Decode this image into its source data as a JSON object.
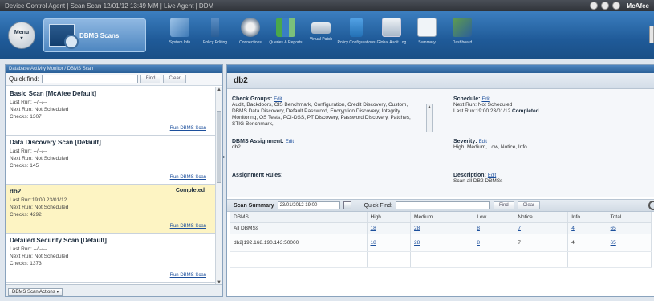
{
  "window": {
    "title": "Device Control Agent | Scan Scan 12/01/12 13:49 MM | Live Agent | DDM",
    "brand": "McAfee"
  },
  "ribbon": {
    "menu_label": "Menu",
    "active_tool": "DBMS Scans",
    "tools": [
      {
        "label": "System Info",
        "icon": "system-info-icon"
      },
      {
        "label": "Policy Editing",
        "icon": "policy-editing-icon"
      },
      {
        "label": "Connections",
        "icon": "connections-icon"
      },
      {
        "label": "Queries & Reports",
        "icon": "reports-icon"
      },
      {
        "label": "Virtual Patch",
        "icon": "virtual-patch-icon"
      },
      {
        "label": "Policy Configurations",
        "icon": "policy-config-icon"
      },
      {
        "label": "Global Audit Log",
        "icon": "audit-log-icon"
      },
      {
        "label": "Summary",
        "icon": "summary-icon"
      },
      {
        "label": "Dashboard",
        "icon": "dashboard-icon"
      }
    ]
  },
  "left": {
    "header": "Database Activity Monitor / DBMS Scan",
    "quickfind_label": "Quick find:",
    "find_btn": "Find",
    "clear_btn": "Clear",
    "footer_btn": "DBMS Scan Actions ▾",
    "scans": [
      {
        "name": "Basic Scan [McAfee Default]",
        "status": "",
        "last": "Last Run: --/--/--",
        "next": "Next Run: Not Scheduled",
        "checks": "Checks: 1307",
        "run": "Run DBMS Scan"
      },
      {
        "name": "Data Discovery Scan [Default]",
        "status": "",
        "last": "Last Run: --/--/--",
        "next": "Next Run: Not Scheduled",
        "checks": "Checks: 145",
        "run": "Run DBMS Scan"
      },
      {
        "name": "db2",
        "status": "Completed",
        "last": "Last Run:19:00 23/01/12",
        "next": "Next Run: Not Scheduled",
        "checks": "Checks: 4292",
        "run": "Run DBMS Scan"
      },
      {
        "name": "Detailed Security Scan [Default]",
        "status": "",
        "last": "Last Run: --/--/--",
        "next": "Next Run: Not Scheduled",
        "checks": "Checks: 1373",
        "run": "Run DBMS Scan"
      }
    ]
  },
  "detail": {
    "title": "db2",
    "check_groups_label": "Check Groups:",
    "check_groups_value": "Audit, Backdoors, CIS Benchmark, Configuration, Credit Discovery, Custom, DBMS Data Discovery, Default Password, Encryption Discovery, Integrity Monitoring, OS Tests, PCI-DSS, PT Discovery, Password Discovery, Patches, STIG Benchmark,",
    "edit": "Edit",
    "schedule_label": "Schedule:",
    "schedule_lines": [
      "Next Run: Not Scheduled",
      "Last Run:19:00 23/01/12"
    ],
    "schedule_done": "Completed",
    "assignment_label": "DBMS Assignment:",
    "assignment_value": "db2",
    "severity_label": "Severity:",
    "severity_value": "High, Medium, Low, Notice, Info",
    "rules_label": "Assignment Rules:",
    "description_label": "Description:",
    "description_value": "Scan all DB2 DBMSs"
  },
  "summary": {
    "label": "Scan Summary",
    "date": "23/01/2012 19:00",
    "quickfind_label": "Quick Find:",
    "find_btn": "Find",
    "clear_btn": "Clear",
    "columns": [
      "DBMS",
      "High",
      "Medium",
      "Low",
      "Notice",
      "Info",
      "Total"
    ],
    "all_row": [
      "All DBMSs",
      "18",
      "28",
      "8",
      "7",
      "4",
      "65"
    ],
    "ip_row": [
      "db2|192.168.190.143:50000",
      "18",
      "28",
      "8",
      "7",
      "4",
      "65"
    ]
  }
}
